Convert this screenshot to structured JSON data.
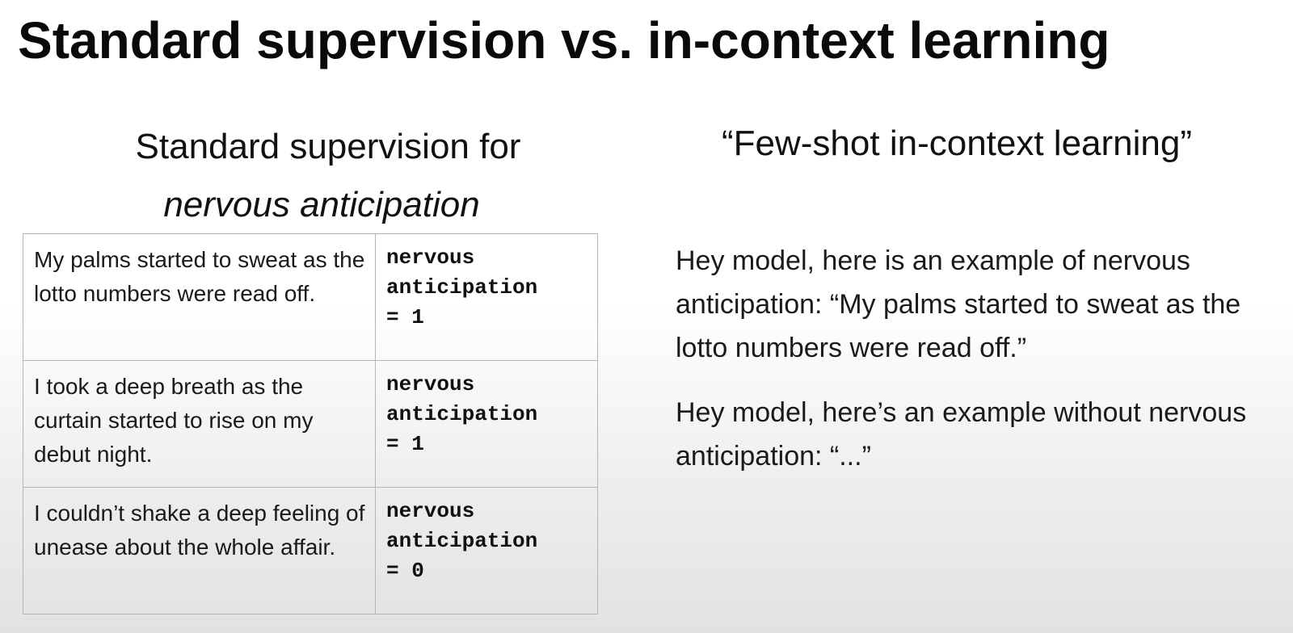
{
  "title": "Standard supervision vs. in-context learning",
  "left": {
    "heading_line1": "Standard supervision for",
    "heading_line2": "nervous anticipation",
    "rows": [
      {
        "text": "My palms started to sweat as the lotto numbers were read off.",
        "label_1": "nervous",
        "label_2": "anticipation",
        "label_3": "= 1"
      },
      {
        "text": "I took a deep breath as the curtain started to rise on my debut night.",
        "label_1": "nervous",
        "label_2": "anticipation",
        "label_3": "= 1"
      },
      {
        "text": "I couldn’t shake a deep feeling of unease about the whole affair.",
        "label_1": "nervous",
        "label_2": "anticipation",
        "label_3": "= 0"
      }
    ]
  },
  "right": {
    "heading": "“Few-shot in-context learning”",
    "paragraph_1": "Hey model, here is an example of nervous anticipation: “My palms started to sweat as the lotto numbers were read off.”",
    "paragraph_2": "Hey model, here’s an example without nervous anticipation: “...”"
  }
}
